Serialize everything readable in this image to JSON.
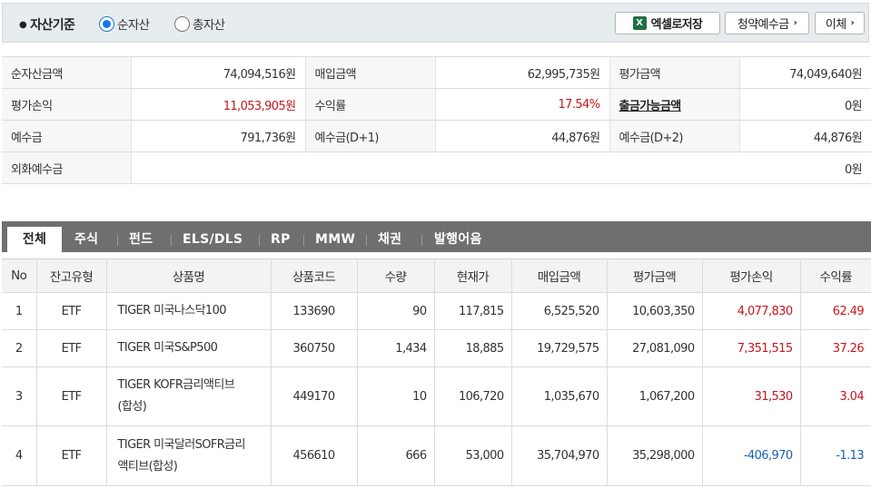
{
  "filter": {
    "title": "자산기준",
    "options": [
      "순자산",
      "총자산"
    ],
    "selected": "순자산",
    "excel_button": "엑셀로저장",
    "subscription_deposit_button": "청약예수금",
    "transfer_button": "이체"
  },
  "summary": {
    "rows": [
      [
        {
          "label": "순자산금액",
          "value": "74,094,516원"
        },
        {
          "label": "매입금액",
          "value": "62,995,735원"
        },
        {
          "label": "평가금액",
          "value": "74,049,640원"
        }
      ],
      [
        {
          "label": "평가손익",
          "value": "11,053,905원"
        },
        {
          "label": "수익률",
          "value": "17.54%"
        },
        {
          "label": "출금가능금액",
          "value": "0원"
        }
      ],
      [
        {
          "label": "예수금",
          "value": "791,736원"
        },
        {
          "label": "예수금(D+1)",
          "value": "44,876원"
        },
        {
          "label": "예수금(D+2)",
          "value": "44,876원"
        }
      ]
    ],
    "fx_deposit": {
      "label": "외화예수금",
      "value": "0원"
    }
  },
  "tabs": [
    "전체",
    "주식",
    "펀드",
    "ELS/DLS",
    "RP",
    "MMW",
    "채권",
    "발행어음"
  ],
  "active_tab": "전체",
  "holdings": {
    "headers": [
      "No",
      "잔고유형",
      "상품명",
      "상품코드",
      "수량",
      "현재가",
      "매입금액",
      "평가금액",
      "평가손익",
      "수익률"
    ],
    "rows": [
      {
        "no": "1",
        "type": "ETF",
        "name_line1": "TIGER 미국나스닥100",
        "name_line2": "",
        "code": "133690",
        "qty": "90",
        "price": "117,815",
        "buy": "6,525,520",
        "eval": "10,603,350",
        "pl": "4,077,830",
        "rate": "62.49"
      },
      {
        "no": "2",
        "type": "ETF",
        "name_line1": "TIGER 미국S&P500",
        "name_line2": "",
        "code": "360750",
        "qty": "1,434",
        "price": "18,885",
        "buy": "19,729,575",
        "eval": "27,081,090",
        "pl": "7,351,515",
        "rate": "37.26"
      },
      {
        "no": "3",
        "type": "ETF",
        "name_line1": "TIGER KOFR금리액티브",
        "name_line2": "(합성)",
        "code": "449170",
        "qty": "10",
        "price": "106,720",
        "buy": "1,035,670",
        "eval": "1,067,200",
        "pl": "31,530",
        "rate": "3.04"
      },
      {
        "no": "4",
        "type": "ETF",
        "name_line1": "TIGER 미국달러SOFR금리",
        "name_line2": "액티브(합성)",
        "code": "456610",
        "qty": "666",
        "price": "53,000",
        "buy": "35,704,970",
        "eval": "35,298,000",
        "pl": "-406,970",
        "rate": "-1.13"
      }
    ]
  },
  "colors": {
    "positive": "#c8161d",
    "negative": "#1a5fb4",
    "tab_bar": "#6f6f6f",
    "filter_bg": "#e7ecee"
  }
}
